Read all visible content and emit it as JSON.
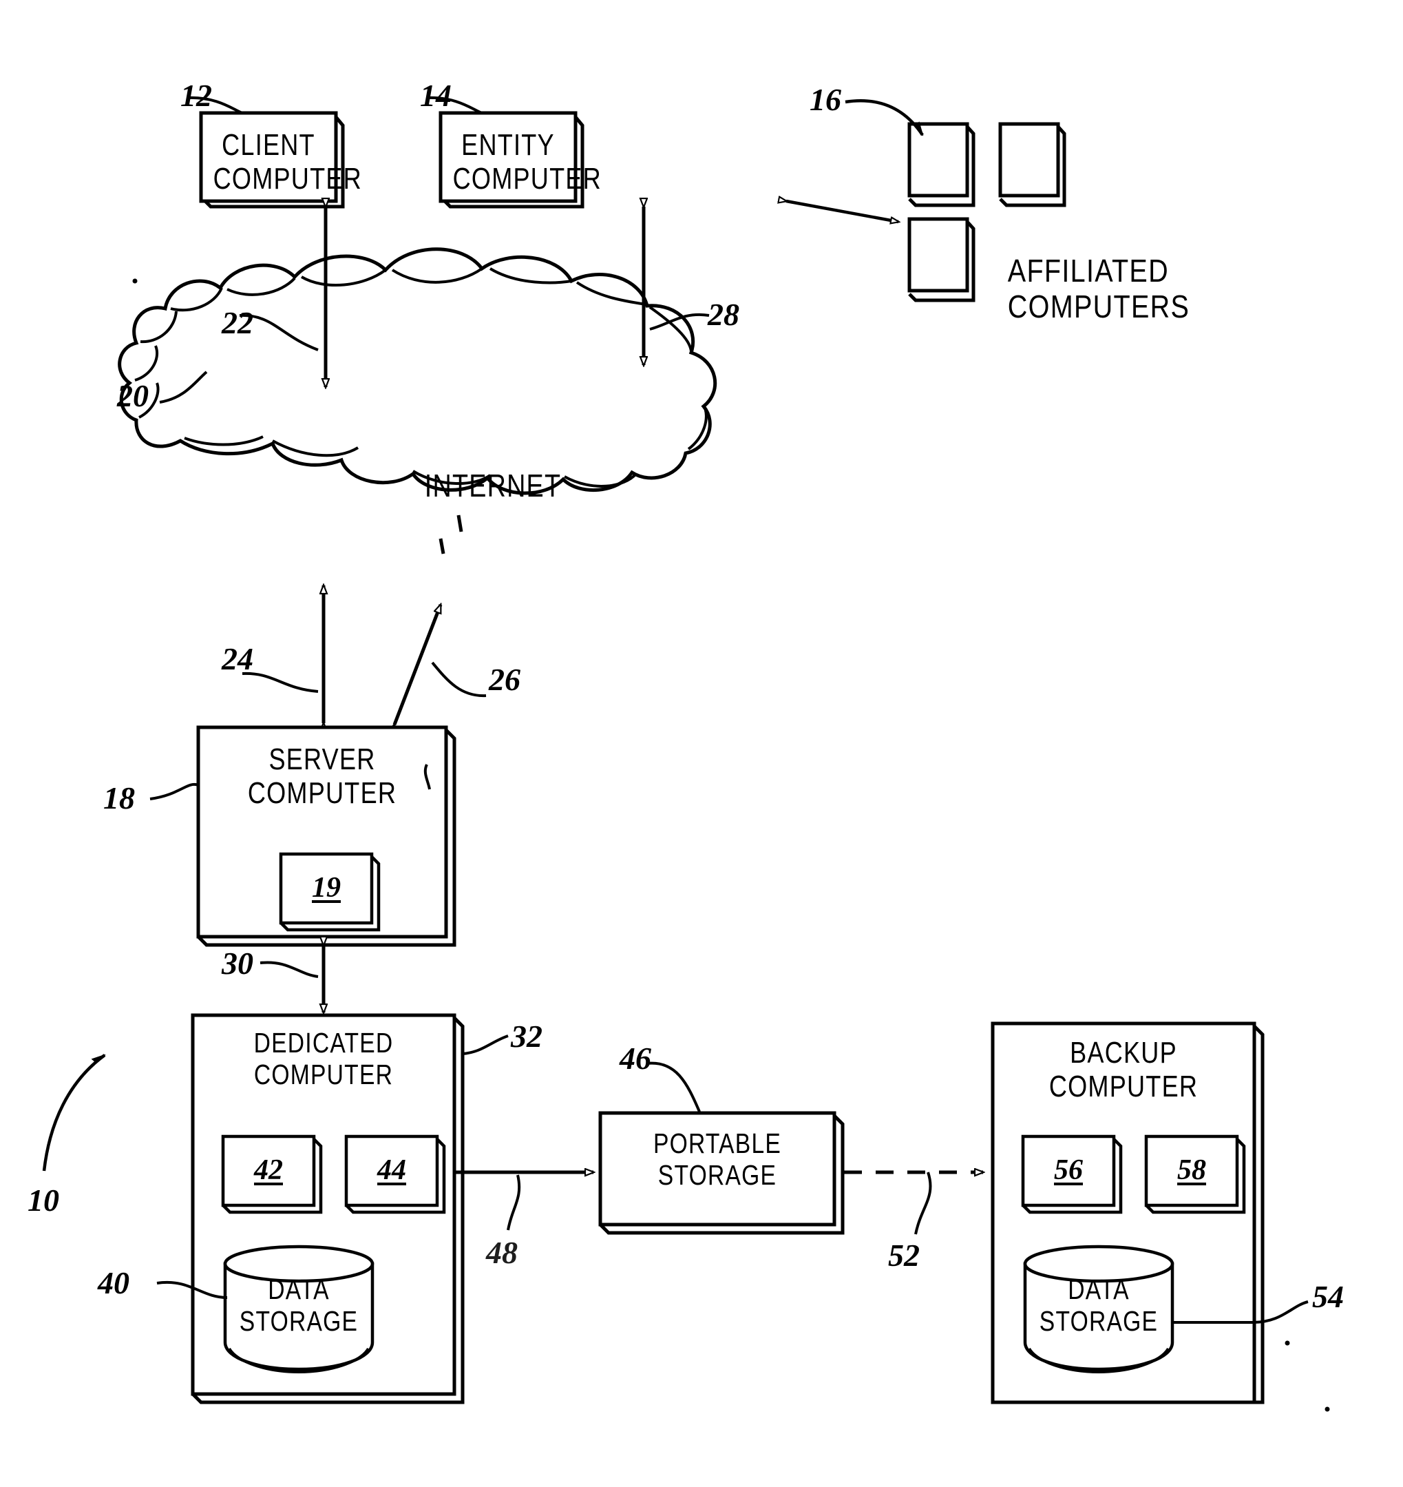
{
  "figure": {
    "type": "patent-system-block-diagram",
    "title": "",
    "background": "#ffffff",
    "ink": "#000000"
  },
  "nodes": {
    "client_computer": {
      "label": "CLIENT\nCOMPUTER",
      "ref": "12"
    },
    "entity_computer": {
      "label": "ENTITY\nCOMPUTER",
      "ref": "14"
    },
    "affiliated_computers": {
      "label": "AFFILIATED\nCOMPUTERS",
      "ref": "16"
    },
    "internet": {
      "label": "INTERNET",
      "ref": "20"
    },
    "server_computer": {
      "label": "SERVER\nCOMPUTER",
      "ref": "18",
      "inner_ref": "19"
    },
    "dedicated_computer": {
      "label": "DEDICATED\nCOMPUTER",
      "ref": "32",
      "module_left_ref": "42",
      "module_right_ref": "44",
      "storage_label": "DATA\nSTORAGE",
      "storage_ref": "40"
    },
    "portable_storage": {
      "label": "PORTABLE\nSTORAGE",
      "ref": "46"
    },
    "backup_computer": {
      "label": "BACKUP\nCOMPUTER",
      "module_left_ref": "56",
      "module_right_ref": "58",
      "storage_label": "DATA\nSTORAGE",
      "storage_ref": "54"
    }
  },
  "connections": {
    "client_to_internet": {
      "ref": "22",
      "style": "double-arrow"
    },
    "entity_to_internet": {
      "ref": "28",
      "style": "double-arrow"
    },
    "internet_to_server_a": {
      "ref": "24",
      "style": "double-arrow"
    },
    "internet_to_server_b": {
      "ref": "26",
      "style": "double-arrow"
    },
    "server_to_dedicated": {
      "ref": "30",
      "style": "double-arrow"
    },
    "dedicated_to_portable": {
      "ref": "48",
      "style": "solid-arrow"
    },
    "portable_to_backup": {
      "ref": "52",
      "style": "dashed-arrow"
    },
    "entity_to_affiliated": {
      "ref": "",
      "style": "double-arrow"
    }
  },
  "system_ref": "10"
}
